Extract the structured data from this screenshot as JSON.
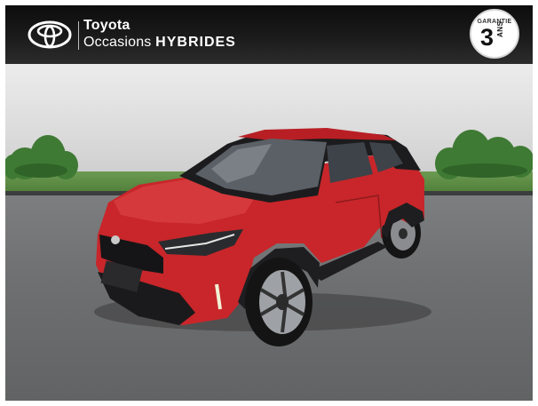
{
  "header": {
    "brand_name": "Toyota",
    "tagline_prefix": "Occasions",
    "tagline_emphasis": "HYBRIDES"
  },
  "warranty_badge": {
    "top_text": "GARANTIE",
    "number": "3",
    "unit": "ANS"
  },
  "colors": {
    "car_body": "#c8262a",
    "car_roof": "#1c1c1e",
    "header_bg": "#141414",
    "lawn": "#5e8c45",
    "ground": "#6f7071"
  },
  "icons": {
    "logo": "toyota-logo-icon"
  }
}
